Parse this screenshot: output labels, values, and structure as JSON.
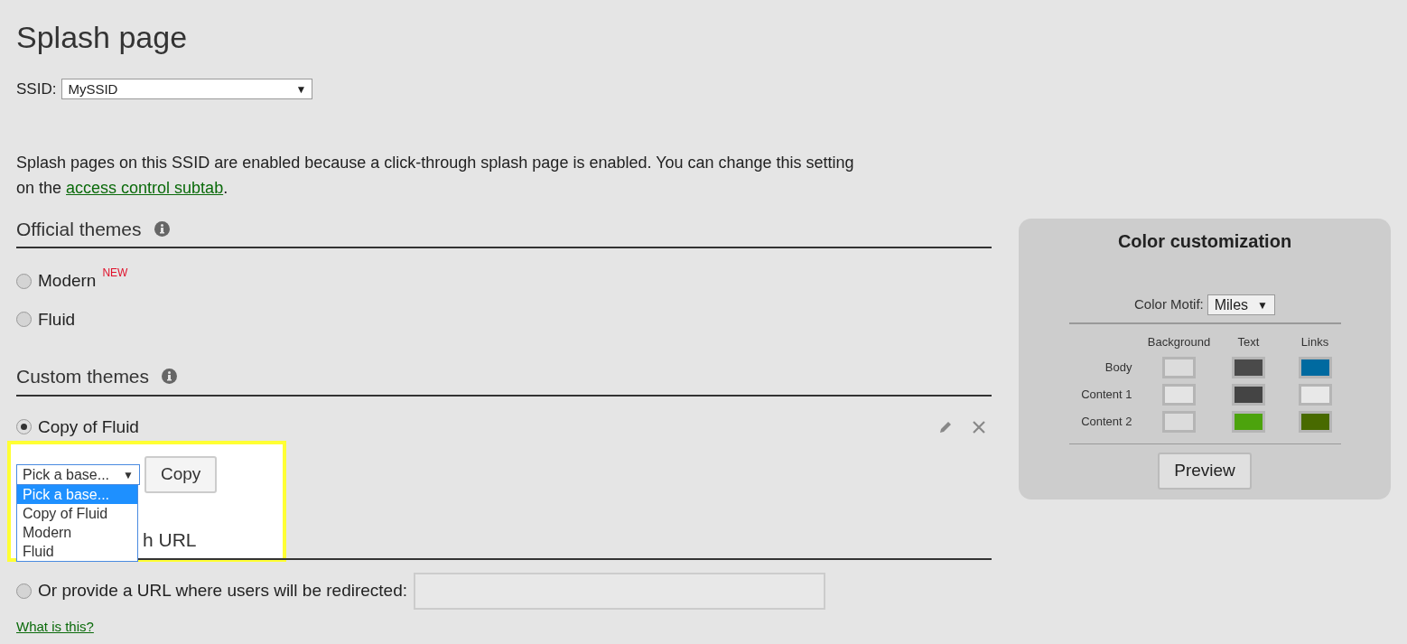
{
  "page_title": "Splash page",
  "ssid": {
    "label": "SSID:",
    "value": "MySSID",
    "arrow": "▼"
  },
  "notice": {
    "text": "Splash pages on this SSID are enabled because a click-through splash page is enabled. You can change this setting on the ",
    "link": "access control subtab",
    "end": "."
  },
  "official_themes": {
    "heading": "Official themes",
    "options": [
      {
        "label": "Modern",
        "badge": "NEW",
        "selected": false
      },
      {
        "label": "Fluid",
        "selected": false
      }
    ]
  },
  "custom_themes": {
    "heading": "Custom themes",
    "options": [
      {
        "label": "Copy of Fluid",
        "selected": true
      }
    ],
    "base_picker": {
      "value": "Pick a base...",
      "arrow": "▼",
      "open": true,
      "options": [
        {
          "label": "Pick a base...",
          "selected": true
        },
        {
          "label": "Copy of Fluid",
          "selected": false
        },
        {
          "label": "Modern",
          "selected": false
        },
        {
          "label": "Fluid",
          "selected": false
        }
      ]
    },
    "copy_button": "Copy"
  },
  "redirect": {
    "heading": "h URL",
    "option": {
      "label": "Or provide a URL where users will be redirected:",
      "selected": false
    },
    "help_link": "What is this?"
  },
  "color_customization": {
    "title": "Color customization",
    "motif_label": "Color Motif:",
    "motif_value": "Miles",
    "motif_arrow": "▼",
    "columns": [
      "Background",
      "Text",
      "Links"
    ],
    "rows": [
      {
        "label": "Body",
        "swatches": [
          {
            "color": "#dcdcdc"
          },
          {
            "color": "#4a4a4a"
          },
          {
            "color": "#006aa0"
          }
        ]
      },
      {
        "label": "Content 1",
        "swatches": [
          {
            "color": "#e4e4e4"
          },
          {
            "color": "#444444"
          },
          {
            "color": "#e8e8e8"
          }
        ]
      },
      {
        "label": "Content 2",
        "swatches": [
          {
            "color": "#dcdcdc"
          },
          {
            "color": "#4ca30d"
          },
          {
            "color": "#486a00"
          }
        ]
      }
    ],
    "preview_button": "Preview"
  }
}
